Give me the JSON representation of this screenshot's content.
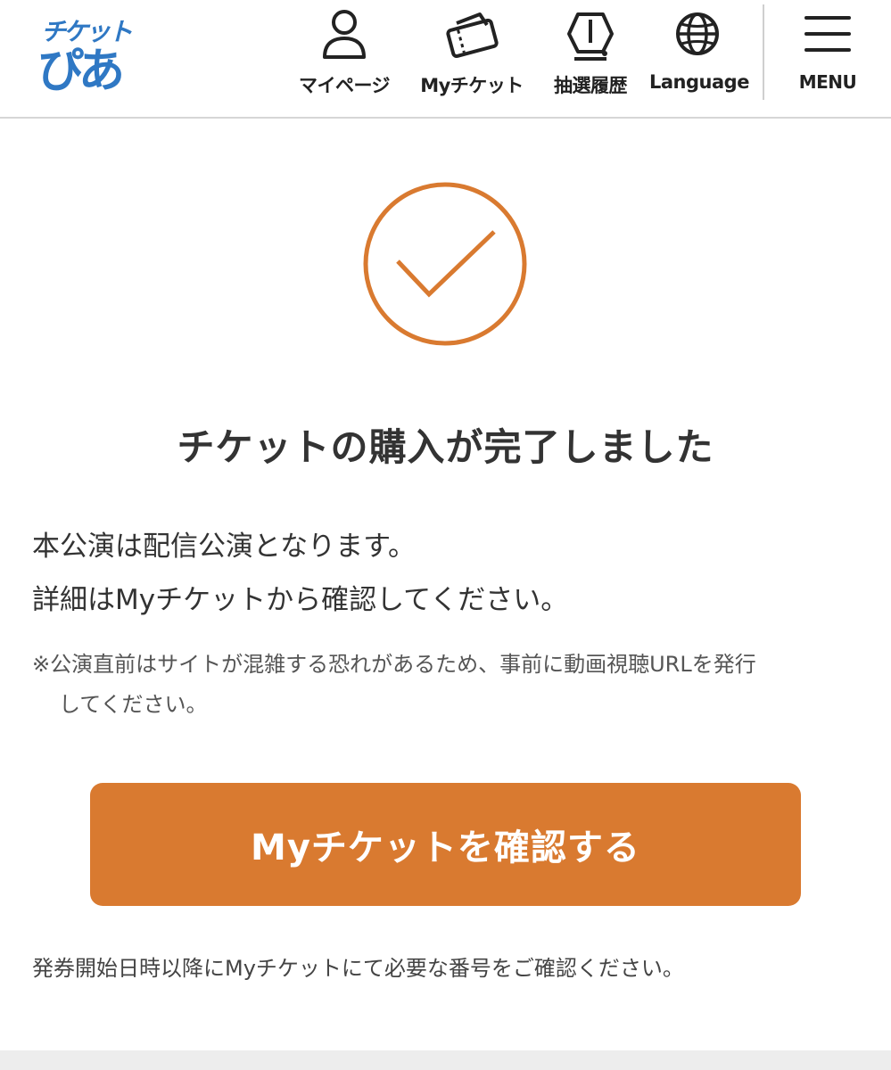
{
  "header": {
    "logo": {
      "line1": "チケット",
      "line2": "ぴあ"
    },
    "nav": {
      "mypage": "マイページ",
      "myticket": "Myチケット",
      "history": "抽選履歴",
      "language": "Language",
      "menu": "MENU"
    }
  },
  "icons": {
    "mypage": "person-icon",
    "myticket": "ticket-icon",
    "history": "lottery-icon",
    "language": "globe-icon",
    "menu": "hamburger-menu-icon",
    "status": "check-circle-icon"
  },
  "main": {
    "title": "チケットの購入が完了しました",
    "message_line1": "本公演は配信公演となります。",
    "message_line2": "詳細はMyチケットから確認してください。",
    "note_line1": "※公演直前はサイトが混雑する恐れがあるため、事前に動画視聴URLを発行",
    "note_line2": "してください。",
    "button_label": "Myチケットを確認する",
    "footnote": "発券開始日時以降にMyチケットにて必要な番号をご確認ください。"
  },
  "colors": {
    "accent": "#d97a30",
    "logo_blue": "#2f78c4",
    "text": "#333333"
  }
}
